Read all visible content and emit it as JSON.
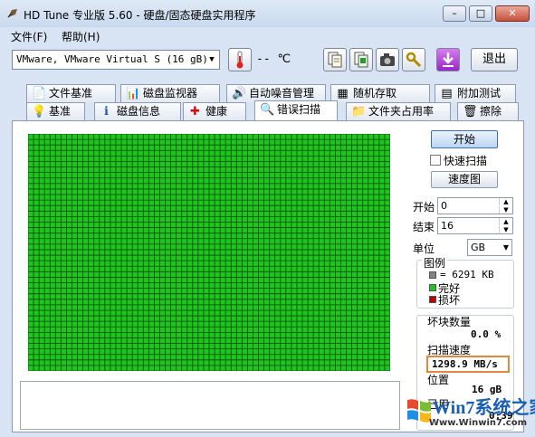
{
  "window": {
    "title": "HD Tune 专业版 5.60 - 硬盘/固态硬盘实用程序",
    "minimize": "–",
    "maximize": "□",
    "close": "✕"
  },
  "menu": {
    "file": "文件(F)",
    "help": "帮助(H)"
  },
  "toolbar": {
    "drive": "VMware, VMware Virtual S (16 gB)",
    "temperature": "-- ℃",
    "exit_label": "退出"
  },
  "tabs_top": [
    "文件基准",
    "磁盘监视器",
    "自动噪音管理",
    "随机存取",
    "附加测试"
  ],
  "tabs_bottom": [
    "基准",
    "磁盘信息",
    "健康",
    "错误扫描",
    "文件夹占用率",
    "擦除"
  ],
  "scan": {
    "start_button": "开始",
    "quick_scan_label": "快速扫描",
    "map_button": "速度图",
    "start_label": "开始",
    "start_value": "0",
    "end_label": "结束",
    "end_value": "16",
    "unit_label": "单位",
    "unit_value": "GB",
    "legend_title": "图例",
    "legend_block": "= 6291 KB",
    "legend_ok": "完好",
    "legend_bad": "损坏",
    "bad_blocks_label": "坏块数量",
    "bad_blocks_value": "0.0 %",
    "speed_label": "扫描速度",
    "speed_value": "1298.9 MB/s",
    "position_label": "位置",
    "position_value": "16 gB",
    "elapsed_label": "已用",
    "elapsed_value": "0:39"
  },
  "colors": {
    "block_good": "#1fc41f",
    "block_bad": "#c00000",
    "highlight": "#e3883a"
  },
  "watermark": {
    "brand": "Win7系统之家",
    "url": "Www.Winwin7.com"
  }
}
